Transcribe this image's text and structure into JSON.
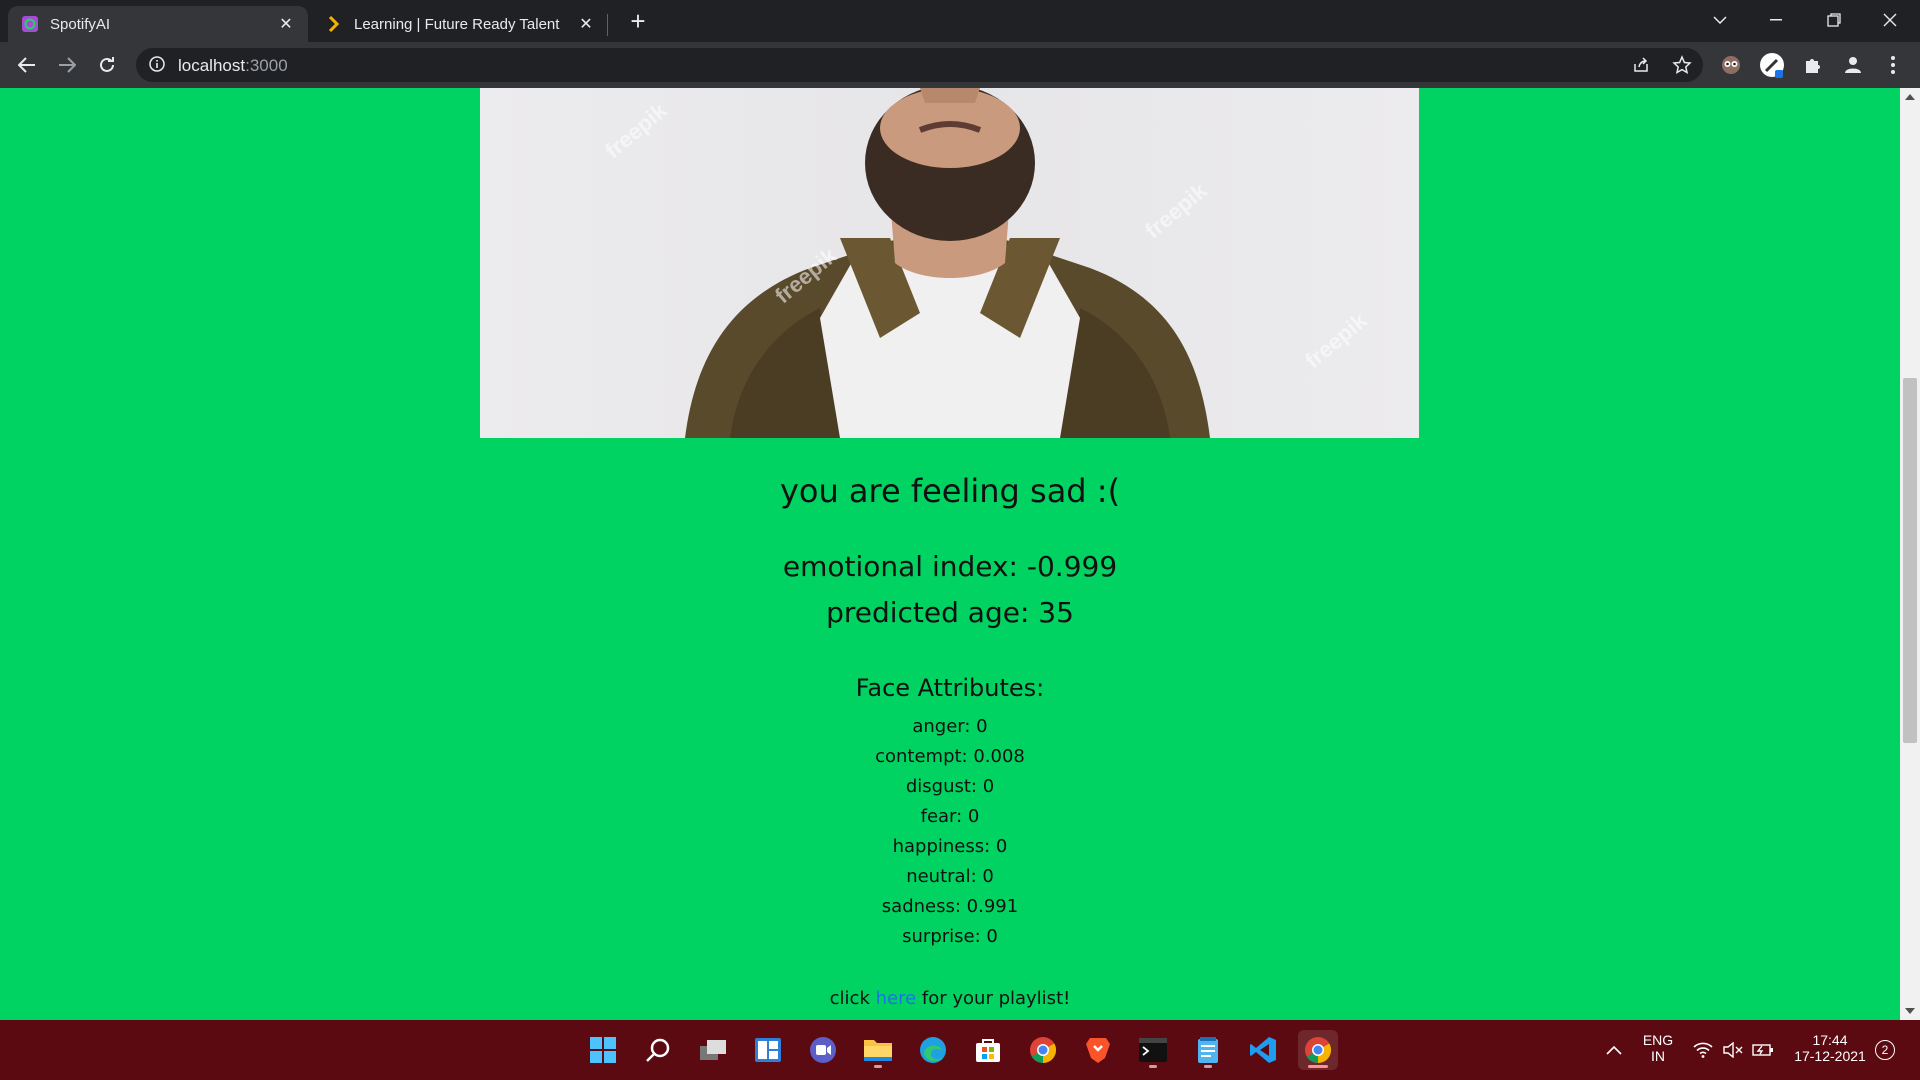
{
  "browser": {
    "tabs": [
      {
        "title": "SpotifyAI",
        "active": true,
        "favicon": "spotify-ai-icon"
      },
      {
        "title": "Learning | Future Ready Talent",
        "active": false,
        "favicon": "future-ready-icon"
      }
    ],
    "url_host": "localhost",
    "url_port": ":3000"
  },
  "page": {
    "mood_text": "you are feeling sad :(",
    "emotional_index": "emotional index: -0.999",
    "predicted_age": "predicted age: 35",
    "attributes_heading": "Face Attributes:",
    "attributes": [
      "anger: 0",
      "contempt: 0.008",
      "disgust: 0",
      "fear: 0",
      "happiness: 0",
      "neutral: 0",
      "sadness: 0.991",
      "surprise: 0"
    ],
    "playlist_prefix": "click",
    "playlist_link": "here",
    "playlist_suffix": "for your playlist!",
    "photo_watermark": "freepik",
    "background_color": "#00d361"
  },
  "taskbar": {
    "apps": [
      "start-icon",
      "search-icon",
      "task-view-icon",
      "widgets-icon",
      "teams-chat-icon",
      "file-explorer-icon",
      "edge-icon",
      "store-icon",
      "chrome-icon",
      "brave-icon",
      "terminal-icon",
      "notepad-icon",
      "vscode-icon",
      "chrome-active-icon"
    ],
    "lang_line1": "ENG",
    "lang_line2": "IN",
    "time": "17:44",
    "date": "17-12-2021",
    "notification_count": "2"
  }
}
